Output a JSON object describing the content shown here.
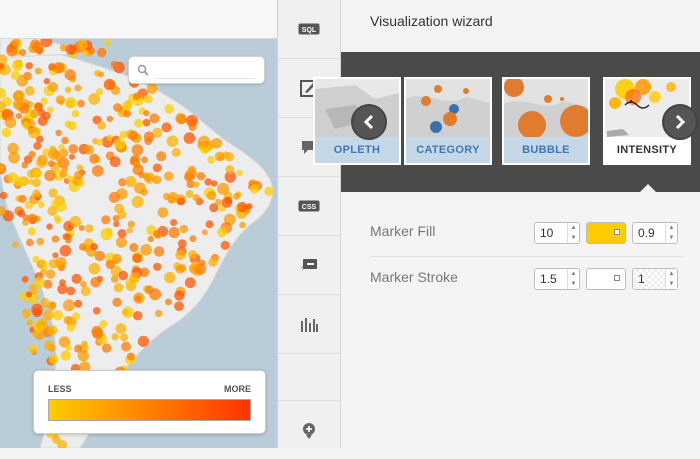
{
  "colors": {
    "ramp_start": "#ffcc00",
    "ramp_end": "#ff3300",
    "fill_color": "#ffcc00",
    "stroke_color": "#ffffff",
    "link": "#3a7ab8"
  },
  "map": {
    "search": {
      "placeholder": ""
    },
    "legend": {
      "less": "LESS",
      "more": "MORE"
    }
  },
  "toolbar": {
    "items": [
      {
        "name": "sql",
        "label": "SQL",
        "icon": "sql-icon"
      },
      {
        "name": "wizard",
        "icon": "brush-icon",
        "active": true
      },
      {
        "name": "infowindow",
        "icon": "speech-bubble-icon"
      },
      {
        "name": "css",
        "label": "CSS",
        "icon": "css-icon"
      },
      {
        "name": "legends",
        "icon": "legend-icon"
      },
      {
        "name": "filters",
        "icon": "bar-chart-icon"
      },
      {
        "name": "add-layer",
        "icon": "add-layer-icon"
      }
    ]
  },
  "panel": {
    "title": "Visualization wizard",
    "wizard": {
      "cards": [
        {
          "label": "OPLETH",
          "selected": false
        },
        {
          "label": "CATEGORY",
          "selected": false
        },
        {
          "label": "BUBBLE",
          "selected": false
        },
        {
          "label": "INTENSITY",
          "selected": true
        }
      ]
    },
    "marker_fill": {
      "label": "Marker Fill",
      "width": "10",
      "opacity": "0.9"
    },
    "marker_stroke": {
      "label": "Marker Stroke",
      "width": "1.5",
      "opacity": "1"
    }
  }
}
